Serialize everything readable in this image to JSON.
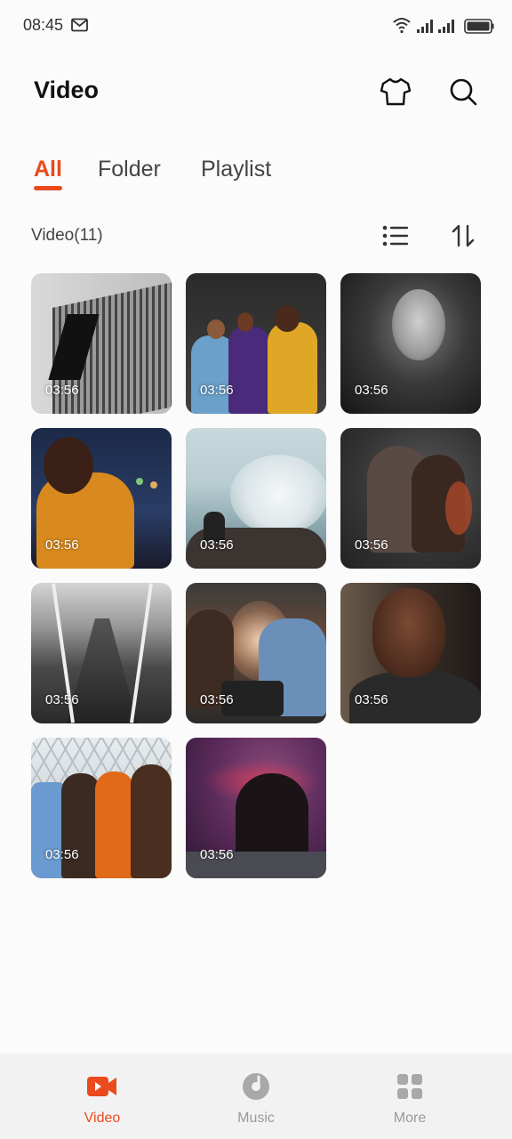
{
  "status_bar": {
    "time": "08:45",
    "icons": [
      "mail-icon",
      "wifi-icon",
      "signal-icon",
      "signal-icon",
      "battery-icon"
    ]
  },
  "header": {
    "title": "Video",
    "actions": [
      "tshirt-icon",
      "search-icon"
    ]
  },
  "tabs": [
    {
      "label": "All",
      "active": true
    },
    {
      "label": "Folder",
      "active": false
    },
    {
      "label": "Playlist",
      "active": false
    }
  ],
  "toolbar": {
    "count_label": "Video(11)",
    "actions": [
      "list-view-icon",
      "sort-icon"
    ]
  },
  "videos": [
    {
      "duration": "03:56"
    },
    {
      "duration": "03:56"
    },
    {
      "duration": "03:56"
    },
    {
      "duration": "03:56"
    },
    {
      "duration": "03:56"
    },
    {
      "duration": "03:56"
    },
    {
      "duration": "03:56"
    },
    {
      "duration": "03:56"
    },
    {
      "duration": "03:56"
    },
    {
      "duration": "03:56"
    },
    {
      "duration": "03:56"
    }
  ],
  "bottom_nav": [
    {
      "label": "Video",
      "icon": "video-camera-icon",
      "active": true
    },
    {
      "label": "Music",
      "icon": "music-disc-icon",
      "active": false
    },
    {
      "label": "More",
      "icon": "grid-icon",
      "active": false
    }
  ],
  "colors": {
    "accent": "#ea4a1c",
    "background": "#fbfbfb",
    "nav_background": "#f2f2f2",
    "inactive": "#9a9a9a"
  }
}
